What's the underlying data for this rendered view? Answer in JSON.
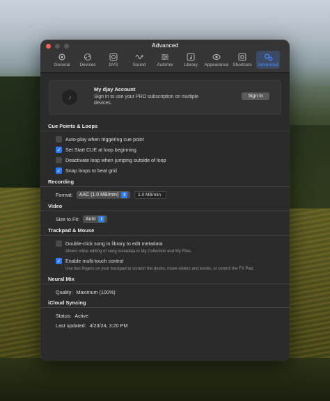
{
  "window": {
    "title": "Advanced"
  },
  "toolbar": {
    "items": [
      {
        "label": "General",
        "icon": "gear-icon"
      },
      {
        "label": "Devices",
        "icon": "devices-icon"
      },
      {
        "label": "DVS",
        "icon": "vinyl-icon"
      },
      {
        "label": "Sound",
        "icon": "waveform-icon"
      },
      {
        "label": "Automix",
        "icon": "automix-icon"
      },
      {
        "label": "Library",
        "icon": "music-note-icon"
      },
      {
        "label": "Appearance",
        "icon": "eye-icon"
      },
      {
        "label": "Shortcuts",
        "icon": "command-icon"
      },
      {
        "label": "Advanced",
        "icon": "gears-icon",
        "active": true
      }
    ]
  },
  "account": {
    "title": "My djay Account",
    "description": "Sign in to use your PRO subscription on multiple devices.",
    "sign_in_label": "Sign In"
  },
  "cue": {
    "section": "Cue Points & Loops",
    "items": [
      {
        "label": "Auto-play when triggering cue point",
        "checked": false
      },
      {
        "label": "Set Start CUE at loop beginning",
        "checked": true
      },
      {
        "label": "Deactivate loop when jumping outside of loop",
        "checked": false
      },
      {
        "label": "Snap loops to beat grid",
        "checked": true
      }
    ]
  },
  "recording": {
    "section": "Recording",
    "format_label": "Format:",
    "format_value": "AAC (1.0 MB/min)",
    "size_value": "1.0 MB/min"
  },
  "video": {
    "section": "Video",
    "size_label": "Size to Fit:",
    "size_value": "Auto"
  },
  "trackpad": {
    "section": "Trackpad & Mouse",
    "items": [
      {
        "label": "Double-click song in library to edit metadata",
        "checked": false,
        "hint": "Allows inline editing of song metadata in My Collection and My Files."
      },
      {
        "label": "Enable multi-touch control",
        "checked": true,
        "hint": "Use two fingers on your trackpad to scratch the decks, move sliders and knobs, or control the FX Pad."
      }
    ]
  },
  "neural": {
    "section": "Neural Mix",
    "quality_label": "Quality:",
    "quality_value": "Maximum (100%)"
  },
  "icloud": {
    "section": "iCloud Syncing",
    "status_label": "Status:",
    "status_value": "Active",
    "updated_label": "Last updated:",
    "updated_value": "4/23/24, 3:20 PM"
  },
  "colors": {
    "accent": "#2f7df6",
    "window_bg": "#2b2b2b"
  }
}
